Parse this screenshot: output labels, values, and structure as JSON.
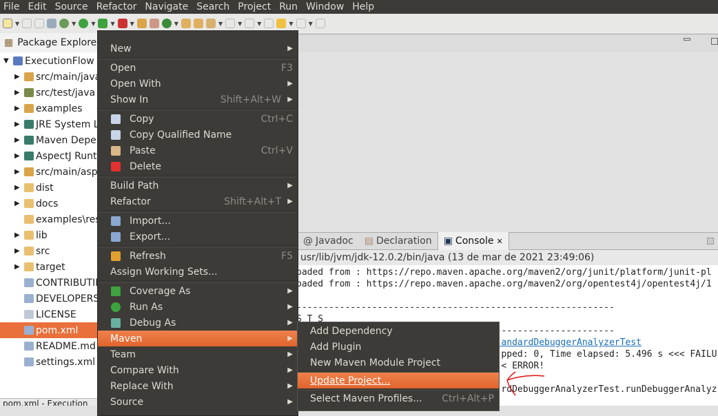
{
  "menubar": [
    "File",
    "Edit",
    "Source",
    "Refactor",
    "Navigate",
    "Search",
    "Project",
    "Run",
    "Window",
    "Help"
  ],
  "explorer": {
    "title": "Package Explorer",
    "project": "ExecutionFlow [",
    "items": [
      {
        "label": "src/main/java",
        "expandable": true
      },
      {
        "label": "src/test/java",
        "expandable": true
      },
      {
        "label": "examples",
        "expandable": true
      },
      {
        "label": "JRE System Li",
        "expandable": true
      },
      {
        "label": "Maven Depen",
        "expandable": true
      },
      {
        "label": "AspectJ Runti",
        "expandable": true
      },
      {
        "label": "src/main/asp",
        "expandable": true
      },
      {
        "label": "dist",
        "expandable": true
      },
      {
        "label": "docs",
        "expandable": true
      },
      {
        "label": "examples\\res",
        "expandable": false
      },
      {
        "label": "lib",
        "expandable": true
      },
      {
        "label": "src",
        "expandable": true
      },
      {
        "label": "target",
        "expandable": true
      },
      {
        "label": "CONTRIBUTIN",
        "expandable": false
      },
      {
        "label": "DEVELOPERS.",
        "expandable": false
      },
      {
        "label": "LICENSE",
        "expandable": false
      },
      {
        "label": "pom.xml",
        "expandable": false,
        "selected": true
      },
      {
        "label": "README.md",
        "expandable": false
      },
      {
        "label": "settings.xml",
        "expandable": false
      }
    ],
    "status": "pom.xml - Execution"
  },
  "context_menu": {
    "items": [
      {
        "label": "New",
        "sub": true
      },
      {
        "sep": true
      },
      {
        "label": "Open",
        "shortcut": "F3"
      },
      {
        "label": "Open With",
        "sub": true
      },
      {
        "label": "Show In",
        "shortcut": "Shift+Alt+W",
        "sub": true
      },
      {
        "sep": true
      },
      {
        "label": "Copy",
        "shortcut": "Ctrl+C",
        "icon": "copy-icon"
      },
      {
        "label": "Copy Qualified Name",
        "icon": "copy-qualified-icon"
      },
      {
        "label": "Paste",
        "shortcut": "Ctrl+V",
        "icon": "paste-icon"
      },
      {
        "label": "Delete",
        "icon": "delete-icon"
      },
      {
        "sep": true
      },
      {
        "label": "Build Path",
        "sub": true
      },
      {
        "label": "Refactor",
        "shortcut": "Shift+Alt+T",
        "sub": true
      },
      {
        "sep": true
      },
      {
        "label": "Import...",
        "icon": "import-icon"
      },
      {
        "label": "Export...",
        "icon": "export-icon"
      },
      {
        "sep": true
      },
      {
        "label": "Refresh",
        "shortcut": "F5",
        "icon": "refresh-icon"
      },
      {
        "label": "Assign Working Sets..."
      },
      {
        "sep": true
      },
      {
        "label": "Coverage As",
        "sub": true,
        "icon": "coverage-icon"
      },
      {
        "label": "Run As",
        "sub": true,
        "icon": "run-icon"
      },
      {
        "label": "Debug As",
        "sub": true,
        "icon": "debug-icon"
      },
      {
        "label": "Maven",
        "sub": true,
        "highlighted": true
      },
      {
        "label": "Team",
        "sub": true
      },
      {
        "label": "Compare With",
        "sub": true
      },
      {
        "label": "Replace With",
        "sub": true
      },
      {
        "label": "Source",
        "sub": true
      }
    ]
  },
  "maven_menu": {
    "items": [
      {
        "label": "Add Dependency"
      },
      {
        "label": "Add Plugin"
      },
      {
        "label": "New Maven Module Project"
      },
      {
        "sep": true
      },
      {
        "label": "Update Project...",
        "highlighted": true
      },
      {
        "sep": true
      },
      {
        "label": "Select Maven Profiles...",
        "shortcut": "Ctrl+Alt+P"
      }
    ]
  },
  "console": {
    "tabs": [
      {
        "label": "Javadoc"
      },
      {
        "label": "Declaration"
      },
      {
        "label": "Console",
        "active": true
      }
    ],
    "path": "usr/lib/jvm/jdk-12.0.2/bin/java (13 de mar de 2021 23:49:06)",
    "lines": [
      "oaded from : https://repo.maven.apache.org/maven2/org/junit/platform/junit-pl",
      "oaded from : https://repo.maven.apache.org/maven2/org/opentest4j/opentest4j/1",
      "",
      "-----------------------------------------------------------",
      "S T S",
      "-----------------------------------------------------------",
      "                                      andardDebuggerAnalyzerTest",
      "                                      pped: 0, Time elapsed: 5.496 s <<< FAILU",
      "                                      < ERROR!",
      "",
      "                                      rdDebuggerAnalyzerTest.runDebuggerAnalyz"
    ]
  },
  "colors": {
    "accent": "#e9703a",
    "menu_bg": "#3c3b37",
    "annotation": "#e01010"
  }
}
